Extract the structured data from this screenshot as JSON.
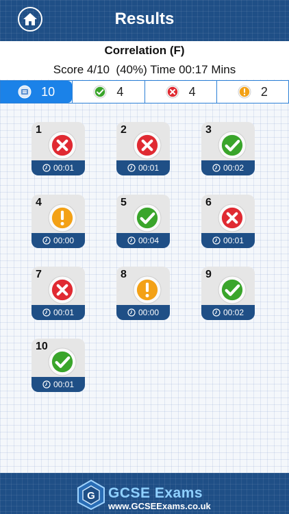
{
  "header": {
    "title": "Results"
  },
  "quiz": {
    "topic": "Correlation (F)",
    "score_line": "Score 4/10  (40%) Time 00:17 Mins"
  },
  "filters": [
    {
      "name": "all",
      "icon": "list-icon",
      "count": "10",
      "active": true
    },
    {
      "name": "correct",
      "icon": "check-icon",
      "count": "4"
    },
    {
      "name": "wrong",
      "icon": "cross-icon",
      "count": "4"
    },
    {
      "name": "skipped",
      "icon": "exclamation-icon",
      "count": "2"
    }
  ],
  "questions": [
    {
      "num": "1",
      "status": "wrong",
      "time": "00:01"
    },
    {
      "num": "2",
      "status": "wrong",
      "time": "00:01"
    },
    {
      "num": "3",
      "status": "correct",
      "time": "00:02"
    },
    {
      "num": "4",
      "status": "skipped",
      "time": "00:00"
    },
    {
      "num": "5",
      "status": "correct",
      "time": "00:04"
    },
    {
      "num": "6",
      "status": "wrong",
      "time": "00:01"
    },
    {
      "num": "7",
      "status": "wrong",
      "time": "00:01"
    },
    {
      "num": "8",
      "status": "skipped",
      "time": "00:00"
    },
    {
      "num": "9",
      "status": "correct",
      "time": "00:02"
    },
    {
      "num": "10",
      "status": "correct",
      "time": "00:01"
    }
  ],
  "footer": {
    "brand": "GCSE Exams",
    "url": "www.GCSEExams.co.uk"
  },
  "colors": {
    "header_bg": "#1f4f86",
    "active_filter": "#1b82e8",
    "correct": "#3aa52b",
    "wrong": "#e02a32",
    "skipped": "#f3a116"
  }
}
